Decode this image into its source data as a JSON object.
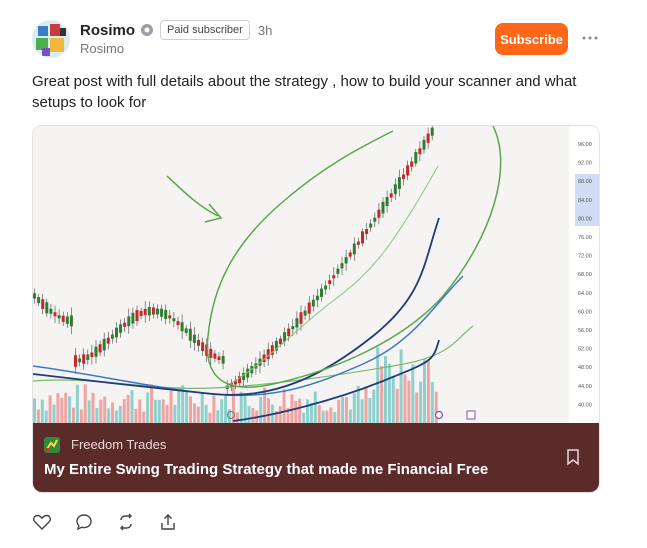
{
  "author": {
    "name": "Rosimo",
    "handle": "Rosimo",
    "badge": "Paid subscriber",
    "time": "3h"
  },
  "header": {
    "subscribe_label": "Subscribe"
  },
  "post": {
    "text": "Great post with full details about the strategy , how to build your scanner and what setups to look for"
  },
  "card": {
    "publication": "Freedom Trades",
    "title": "My Entire Swing Trading Strategy that made me Financial Free",
    "chart_price_labels": [
      "96.00",
      "92.00",
      "88.00",
      "84.00",
      "80.00",
      "76.00",
      "72.00",
      "68.00",
      "64.00",
      "60.00",
      "56.00",
      "52.00",
      "48.00",
      "44.00",
      "40.00"
    ]
  },
  "actions": [
    "heart-icon",
    "comment-icon",
    "restack-icon",
    "share-icon"
  ],
  "colors": {
    "accent": "#ff6719",
    "card_footer": "#5b2b2a",
    "bull": "#2e7d32",
    "bear": "#c62828",
    "annotation": "#5aa64a"
  }
}
